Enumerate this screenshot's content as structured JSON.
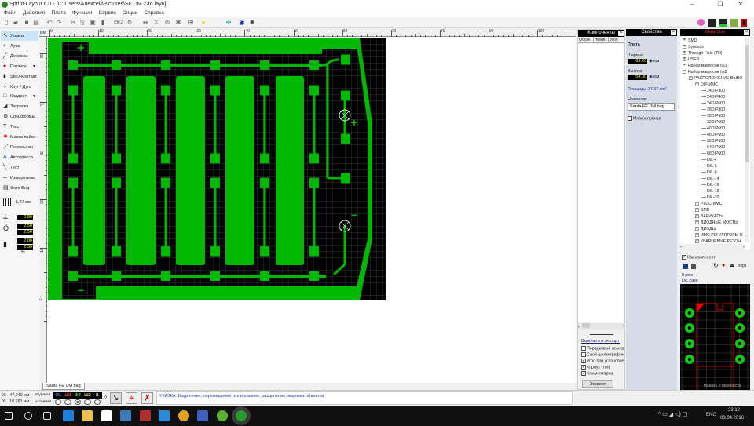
{
  "window": {
    "title": "Sprint-Layout 6.0 - [C:\\Users\\Алексей\\Pictures\\SF DM Zad.lay6]",
    "minimize": "–",
    "maximize": "❐",
    "close": "✕"
  },
  "menu": [
    "Файл",
    "Действия",
    "Плата",
    "Функции",
    "Сервис",
    "Опции",
    "Справка"
  ],
  "toolbar_icons": [
    "new-icon",
    "open-icon",
    "save-icon",
    "print-icon",
    "undo-icon",
    "redo-icon",
    "cut-icon",
    "copy-icon",
    "paste-icon",
    "delete-icon",
    "duplicate-icon",
    "rotate-icon",
    "mirror-h-icon",
    "mirror-v-icon",
    "align-icon",
    "group-icon",
    "ungroup-icon",
    "zoom-icon",
    "connections-icon",
    "drc-icon",
    "settings-icon"
  ],
  "toolbar_zoom_label": "×2",
  "tools": [
    {
      "label": "Указка",
      "icon": "pointer-icon",
      "glyph": "↖",
      "selected": true
    },
    {
      "label": "Лупа",
      "icon": "magnifier-icon",
      "glyph": "⌕"
    },
    {
      "label": "Дорожка",
      "icon": "track-icon",
      "glyph": "╱"
    },
    {
      "label": "Пятачок",
      "icon": "pad-icon",
      "glyph": "●",
      "dropdown": true
    },
    {
      "label": "SMD-Контакт",
      "icon": "smd-pad-icon",
      "glyph": "▮"
    },
    {
      "label": "Круг / Дуга",
      "icon": "circle-icon",
      "glyph": "○"
    },
    {
      "label": "Квадрат",
      "icon": "square-icon",
      "glyph": "□",
      "dropdown": true
    },
    {
      "label": "Закраска",
      "icon": "fill-icon",
      "glyph": "◢"
    },
    {
      "label": "Спецформы",
      "icon": "special-forms-icon",
      "glyph": "⚙"
    },
    {
      "label": "Текст",
      "icon": "text-icon",
      "glyph": "T"
    },
    {
      "label": "Маска пайки",
      "icon": "solder-mask-icon",
      "glyph": "✹"
    },
    {
      "label": "Перемычки",
      "icon": "jumper-icon",
      "glyph": "⋰"
    },
    {
      "label": "Автотрасса",
      "icon": "autoroute-icon",
      "glyph": "A"
    },
    {
      "label": "Тест",
      "icon": "test-icon",
      "glyph": "╲"
    },
    {
      "label": "Измеритель",
      "icon": "measure-icon",
      "glyph": "═"
    },
    {
      "label": "Фото Вид",
      "icon": "photo-view-icon",
      "glyph": "▤"
    }
  ],
  "grid": {
    "label": "1,27 мм"
  },
  "track_width": "0.80",
  "pad_outer": "2.50",
  "pad_inner": "2.50",
  "smd_w": "2.00",
  "smd_h": "2.30",
  "ruler": {
    "unit": "мм",
    "h_ticks": [
      "0",
      "10",
      "20",
      "30",
      "40",
      "50",
      "60",
      "70",
      "80",
      "90",
      "100"
    ],
    "v_ticks": [
      "50",
      "40",
      "30",
      "20",
      "10",
      "0"
    ]
  },
  "board": {
    "board_color": "#000000",
    "copper_color": "#00b800",
    "plus": "+",
    "minus": "–"
  },
  "layer_tab": "Santa FE DM bag",
  "components": {
    "title": "Компоненты",
    "columns": [
      "Обозн.",
      "Номин.",
      "Угол"
    ],
    "export_link": "Включить в экспорт:",
    "export_options": [
      {
        "label": "Порядковый номер",
        "checked": false
      },
      {
        "label": "Слой шелкографии",
        "checked": false
      },
      {
        "label": "Угол при установке",
        "checked": true
      },
      {
        "label": "Корпус (тип)",
        "checked": true
      },
      {
        "label": "Комментарии",
        "checked": true
      }
    ],
    "export_button": "Экспорт"
  },
  "properties": {
    "title": "Свойства",
    "section": "Плата",
    "width_label": "Ширина:",
    "width_value": "69.20",
    "height_label": "Высота:",
    "height_value": "54.00",
    "unit": "мм",
    "area": "Площадь: 37,37 cm²",
    "name_label": "Название:",
    "name_value": "Santa FE DM bag",
    "multilayer": "Многослойная"
  },
  "macros": {
    "title": "Макросы",
    "tree": [
      {
        "l": "SMD",
        "d": 0,
        "e": "+"
      },
      {
        "l": "Symbols",
        "d": 0,
        "e": "+"
      },
      {
        "l": "Through-Hole (TH)",
        "d": 0,
        "e": "+"
      },
      {
        "l": "USER",
        "d": 0,
        "e": "+"
      },
      {
        "l": "Набор макросов №1",
        "d": 0,
        "e": "+"
      },
      {
        "l": "Набор макросов №2",
        "d": 0,
        "e": "-"
      },
      {
        "l": "РАСПОЛОЖЕНИЕ ВЫВО",
        "d": 1,
        "e": "-"
      },
      {
        "l": "DIP-ИМС",
        "d": 2,
        "e": "-"
      },
      {
        "l": "24DIP300",
        "d": 3
      },
      {
        "l": "24DIP400",
        "d": 3
      },
      {
        "l": "24DIP600",
        "d": 3
      },
      {
        "l": "28DIP300",
        "d": 3
      },
      {
        "l": "28DIP600",
        "d": 3
      },
      {
        "l": "32DIP600",
        "d": 3
      },
      {
        "l": "40DIP600",
        "d": 3
      },
      {
        "l": "48DIP600",
        "d": 3
      },
      {
        "l": "52DIP600",
        "d": 3
      },
      {
        "l": "64DIP600",
        "d": 3
      },
      {
        "l": "68DIP600",
        "d": 3
      },
      {
        "l": "DIL-4",
        "d": 3
      },
      {
        "l": "DIL-6",
        "d": 3
      },
      {
        "l": "DIL-8",
        "d": 3
      },
      {
        "l": "DIL-14",
        "d": 3
      },
      {
        "l": "DIL-16",
        "d": 3
      },
      {
        "l": "DIL-18",
        "d": 3
      },
      {
        "l": "DIL-20",
        "d": 3
      },
      {
        "l": "PLCC-ИМС",
        "d": 2,
        "e": "+"
      },
      {
        "l": "SMD",
        "d": 2,
        "e": "+"
      },
      {
        "l": "ВАРИКАПЫ",
        "d": 2,
        "e": "+"
      },
      {
        "l": "ДИОДНЫЕ МОСТЫ",
        "d": 2,
        "e": "+"
      },
      {
        "l": "ДИОДЫ",
        "d": 2,
        "e": "+"
      },
      {
        "l": "ИМС РЕГУЛЯТОРЫ Н",
        "d": 2,
        "e": "+"
      },
      {
        "l": "КВАРЦЕВЫЕ РЕЗОН",
        "d": 2,
        "e": "+"
      }
    ],
    "as_component": "Как компонент",
    "top_label": "Верх",
    "info1": "8 pins",
    "info2": "DIL case",
    "preview_hint": "Нажать и перенести"
  },
  "status": {
    "x_label": "X:",
    "x_value": "47,040 мм",
    "y_label": "Y:",
    "y_value": "10,160 мм",
    "visible_label": "видимая",
    "active_label": "активная",
    "layers": [
      {
        "name": "Ф1",
        "color": "#4aa3ff"
      },
      {
        "name": "Ш1",
        "color": "#ff4040"
      },
      {
        "name": "Ф2",
        "color": "#40d040"
      },
      {
        "name": "Ш2",
        "color": "#e0e040"
      },
      {
        "name": "К",
        "color": "#ffffff"
      }
    ],
    "active_layer": "Ф2",
    "help": "?",
    "hint": "УКАЗКА: Выделение, перемещение, копирование, разделение, вырезка объектов"
  },
  "taskbar": {
    "icons": [
      "start-icon",
      "search-icon",
      "task-view-icon",
      "edge-icon",
      "explorer-icon",
      "store-icon",
      "app-icon",
      "app2-icon",
      "app3-icon",
      "chrome-icon",
      "floppy-icon",
      "utorrent-icon",
      "sprint-layout-icon"
    ],
    "lang": "ENG",
    "time": "23:12",
    "date": "03.04.2016"
  }
}
